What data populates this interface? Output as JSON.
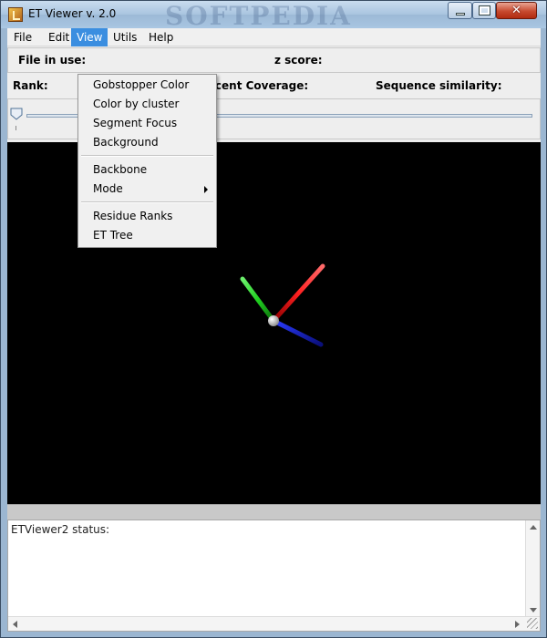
{
  "window": {
    "title": "ET Viewer v. 2.0",
    "watermark": "SOFTPEDIA"
  },
  "menubar": {
    "items": [
      "File",
      "Edit",
      "View",
      "Utils",
      "Help"
    ],
    "active": "View"
  },
  "info": {
    "file_in_use_label": "File in use:",
    "z_score_label": "z score:",
    "rank_label": "Rank:",
    "percent_coverage_label": "rcent Coverage:",
    "sequence_similarity_label": "Sequence similarity:"
  },
  "view_menu": {
    "items": [
      "Gobstopper Color",
      "Color by cluster",
      "Segment Focus",
      "Background",
      "Backbone",
      "Mode",
      "Residue Ranks",
      "ET Tree"
    ],
    "submenu_item": "Mode"
  },
  "status": {
    "text": "ETViewer2 status:"
  },
  "axes": {
    "x_color": "#ff2020",
    "y_color": "#20d020",
    "z_color": "#1a2cff",
    "origin_color": "#ffffff"
  }
}
